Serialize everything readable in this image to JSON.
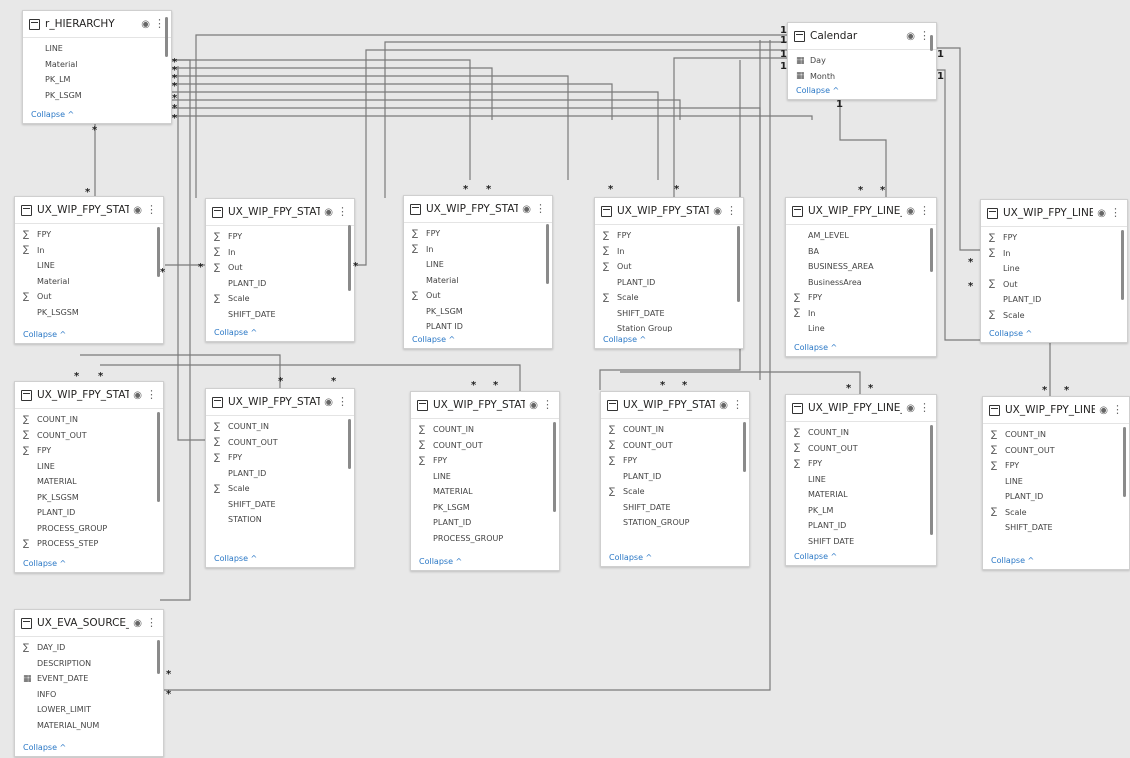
{
  "icons": {
    "sum": "∑",
    "date": "▦",
    "eye": "visibility-icon",
    "more": "more-options-icon"
  },
  "collapse_label": "Collapse ^",
  "cardinality": {
    "many": "*",
    "one": "1"
  },
  "tables": [
    {
      "title": "r_HIERARCHY",
      "fields": [
        {
          "label": "LINE",
          "icon": ""
        },
        {
          "label": "Material",
          "icon": ""
        },
        {
          "label": "PK_LM",
          "icon": ""
        },
        {
          "label": "PK_LSGM",
          "icon": ""
        }
      ]
    },
    {
      "title": "Calendar",
      "fields": [
        {
          "label": "Day",
          "icon": "date"
        },
        {
          "label": "Month",
          "icon": "date"
        }
      ]
    },
    {
      "title": "UX_WIP_FPY_STATIO...",
      "fields": [
        {
          "label": "FPY",
          "icon": "sum"
        },
        {
          "label": "In",
          "icon": "sum"
        },
        {
          "label": "LINE",
          "icon": ""
        },
        {
          "label": "Material",
          "icon": ""
        },
        {
          "label": "Out",
          "icon": "sum"
        },
        {
          "label": "PK_LSGSM",
          "icon": ""
        }
      ]
    },
    {
      "title": "UX_WIP_FPY_STATIO...",
      "fields": [
        {
          "label": "FPY",
          "icon": "sum"
        },
        {
          "label": "In",
          "icon": "sum"
        },
        {
          "label": "Out",
          "icon": "sum"
        },
        {
          "label": "PLANT_ID",
          "icon": ""
        },
        {
          "label": "Scale",
          "icon": "sum"
        },
        {
          "label": "SHIFT_DATE",
          "icon": ""
        }
      ]
    },
    {
      "title": "UX_WIP_FPY_STATIO...",
      "fields": [
        {
          "label": "FPY",
          "icon": "sum"
        },
        {
          "label": "In",
          "icon": "sum"
        },
        {
          "label": "LINE",
          "icon": ""
        },
        {
          "label": "Material",
          "icon": ""
        },
        {
          "label": "Out",
          "icon": "sum"
        },
        {
          "label": "PK_LSGM",
          "icon": ""
        },
        {
          "label": "PLANT ID",
          "icon": ""
        }
      ]
    },
    {
      "title": "UX_WIP_FPY_STATIO...",
      "fields": [
        {
          "label": "FPY",
          "icon": "sum"
        },
        {
          "label": "In",
          "icon": "sum"
        },
        {
          "label": "Out",
          "icon": "sum"
        },
        {
          "label": "PLANT_ID",
          "icon": ""
        },
        {
          "label": "Scale",
          "icon": "sum"
        },
        {
          "label": "SHIFT_DATE",
          "icon": ""
        },
        {
          "label": "Station Group",
          "icon": ""
        }
      ]
    },
    {
      "title": "UX_WIP_FPY_LINE_DA...",
      "fields": [
        {
          "label": "AM_LEVEL",
          "icon": ""
        },
        {
          "label": "BA",
          "icon": ""
        },
        {
          "label": "BUSINESS_AREA",
          "icon": ""
        },
        {
          "label": "BusinessArea",
          "icon": ""
        },
        {
          "label": "FPY",
          "icon": "sum"
        },
        {
          "label": "In",
          "icon": "sum"
        },
        {
          "label": "Line",
          "icon": ""
        }
      ]
    },
    {
      "title": "UX_WIP_FPY_LINE_DA...",
      "fields": [
        {
          "label": "FPY",
          "icon": "sum"
        },
        {
          "label": "In",
          "icon": "sum"
        },
        {
          "label": "Line",
          "icon": ""
        },
        {
          "label": "Out",
          "icon": "sum"
        },
        {
          "label": "PLANT_ID",
          "icon": ""
        },
        {
          "label": "Scale",
          "icon": "sum"
        }
      ]
    },
    {
      "title": "UX_WIP_FPY_STATIO...",
      "fields": [
        {
          "label": "COUNT_IN",
          "icon": "sum"
        },
        {
          "label": "COUNT_OUT",
          "icon": "sum"
        },
        {
          "label": "FPY",
          "icon": "sum"
        },
        {
          "label": "LINE",
          "icon": ""
        },
        {
          "label": "MATERIAL",
          "icon": ""
        },
        {
          "label": "PK_LSGSM",
          "icon": ""
        },
        {
          "label": "PLANT_ID",
          "icon": ""
        },
        {
          "label": "PROCESS_GROUP",
          "icon": ""
        },
        {
          "label": "PROCESS_STEP",
          "icon": "sum"
        }
      ]
    },
    {
      "title": "UX_WIP_FPY_STATIO...",
      "fields": [
        {
          "label": "COUNT_IN",
          "icon": "sum"
        },
        {
          "label": "COUNT_OUT",
          "icon": "sum"
        },
        {
          "label": "FPY",
          "icon": "sum"
        },
        {
          "label": "PLANT_ID",
          "icon": ""
        },
        {
          "label": "Scale",
          "icon": "sum"
        },
        {
          "label": "SHIFT_DATE",
          "icon": ""
        },
        {
          "label": "STATION",
          "icon": ""
        }
      ]
    },
    {
      "title": "UX_WIP_FPY_STATIO...",
      "fields": [
        {
          "label": "COUNT_IN",
          "icon": "sum"
        },
        {
          "label": "COUNT_OUT",
          "icon": "sum"
        },
        {
          "label": "FPY",
          "icon": "sum"
        },
        {
          "label": "LINE",
          "icon": ""
        },
        {
          "label": "MATERIAL",
          "icon": ""
        },
        {
          "label": "PK_LSGM",
          "icon": ""
        },
        {
          "label": "PLANT_ID",
          "icon": ""
        },
        {
          "label": "PROCESS_GROUP",
          "icon": ""
        }
      ]
    },
    {
      "title": "UX_WIP_FPY_STATIO...",
      "fields": [
        {
          "label": "COUNT_IN",
          "icon": "sum"
        },
        {
          "label": "COUNT_OUT",
          "icon": "sum"
        },
        {
          "label": "FPY",
          "icon": "sum"
        },
        {
          "label": "PLANT_ID",
          "icon": ""
        },
        {
          "label": "Scale",
          "icon": "sum"
        },
        {
          "label": "SHIFT_DATE",
          "icon": ""
        },
        {
          "label": "STATION_GROUP",
          "icon": ""
        }
      ]
    },
    {
      "title": "UX_WIP_FPY_LINE_DA...",
      "fields": [
        {
          "label": "COUNT_IN",
          "icon": "sum"
        },
        {
          "label": "COUNT_OUT",
          "icon": "sum"
        },
        {
          "label": "FPY",
          "icon": "sum"
        },
        {
          "label": "LINE",
          "icon": ""
        },
        {
          "label": "MATERIAL",
          "icon": ""
        },
        {
          "label": "PK_LM",
          "icon": ""
        },
        {
          "label": "PLANT_ID",
          "icon": ""
        },
        {
          "label": "SHIFT DATE",
          "icon": ""
        }
      ]
    },
    {
      "title": "UX_WIP_FPY_LINE_DA...",
      "fields": [
        {
          "label": "COUNT_IN",
          "icon": "sum"
        },
        {
          "label": "COUNT_OUT",
          "icon": "sum"
        },
        {
          "label": "FPY",
          "icon": "sum"
        },
        {
          "label": "LINE",
          "icon": ""
        },
        {
          "label": "PLANT_ID",
          "icon": ""
        },
        {
          "label": "Scale",
          "icon": "sum"
        },
        {
          "label": "SHIFT_DATE",
          "icon": ""
        }
      ]
    },
    {
      "title": "UX_EVA_SOURCE_FAIL",
      "fields": [
        {
          "label": "DAY_ID",
          "icon": "sum"
        },
        {
          "label": "DESCRIPTION",
          "icon": ""
        },
        {
          "label": "EVENT_DATE",
          "icon": "date"
        },
        {
          "label": "INFO",
          "icon": ""
        },
        {
          "label": "LOWER_LIMIT",
          "icon": ""
        },
        {
          "label": "MATERIAL_NUM",
          "icon": ""
        }
      ]
    }
  ]
}
